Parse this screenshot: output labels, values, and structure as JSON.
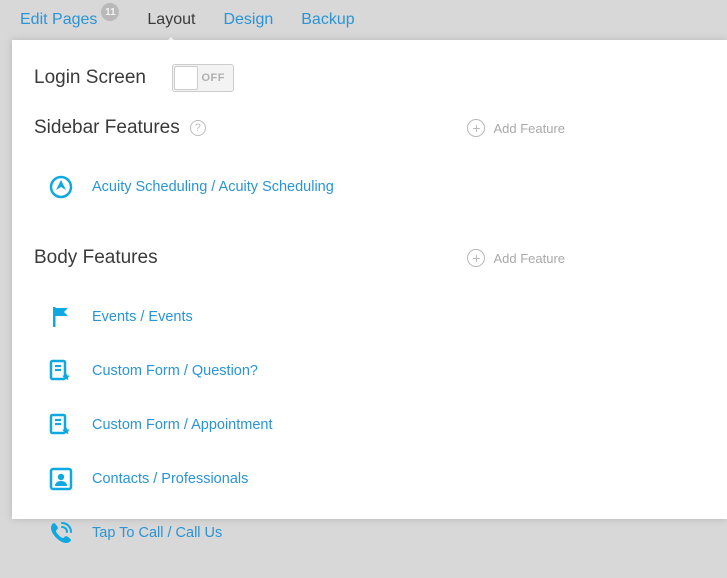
{
  "tabs": [
    {
      "label": "Edit Pages",
      "badge": "11"
    },
    {
      "label": "Layout"
    },
    {
      "label": "Design"
    },
    {
      "label": "Backup"
    }
  ],
  "activeTab": "Layout",
  "login": {
    "title": "Login Screen",
    "toggleState": "OFF"
  },
  "sidebarSection": {
    "title": "Sidebar Features",
    "addLabel": "Add Feature",
    "items": [
      {
        "icon": "acuity",
        "label": "Acuity Scheduling / Acuity Scheduling"
      }
    ]
  },
  "bodySection": {
    "title": "Body Features",
    "addLabel": "Add Feature",
    "items": [
      {
        "icon": "flag",
        "label": "Events / Events"
      },
      {
        "icon": "formstar",
        "label": "Custom Form / Question?"
      },
      {
        "icon": "formstar",
        "label": "Custom Form / Appointment"
      },
      {
        "icon": "contact",
        "label": "Contacts / Professionals"
      },
      {
        "icon": "phone",
        "label": "Tap To Call / Call Us"
      }
    ]
  },
  "colors": {
    "accent": "#2a94d6"
  }
}
